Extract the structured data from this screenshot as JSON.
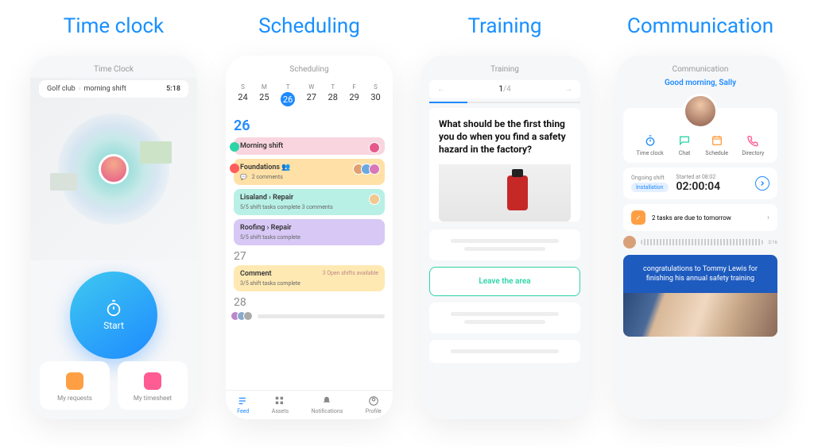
{
  "headings": [
    "Time clock",
    "Scheduling",
    "Training",
    "Communication"
  ],
  "timeclock": {
    "title": "Time Clock",
    "breadcrumb": {
      "location": "Golf club",
      "shift": "morning shift"
    },
    "elapsed": "5:18",
    "start_label": "Start",
    "tiles": {
      "requests": "My requests",
      "timesheet": "My timesheet"
    }
  },
  "scheduling": {
    "title": "Scheduling",
    "week": [
      {
        "dow": "S",
        "num": "24"
      },
      {
        "dow": "M",
        "num": "25"
      },
      {
        "dow": "T",
        "num": "26",
        "active": true
      },
      {
        "dow": "W",
        "num": "27"
      },
      {
        "dow": "T",
        "num": "28"
      },
      {
        "dow": "F",
        "num": "29"
      },
      {
        "dow": "S",
        "num": "30"
      }
    ],
    "big_day": "26",
    "cards": [
      {
        "title": "Morning shift",
        "color": "#f9d5e0",
        "comments": ""
      },
      {
        "title": "Foundations",
        "color": "#ffe0a6",
        "people_icon": true,
        "meta": "2 comments"
      },
      {
        "title": "Lisaland  ›  Repair",
        "color": "#b8f0e6",
        "meta": "5/5 shift tasks complete   3 comments"
      },
      {
        "title": "Roofing  ›  Repair",
        "color": "#d7c8f5",
        "meta": "5/5 shift tasks complete"
      }
    ],
    "day27": "27",
    "card27": {
      "title": "Comment",
      "color": "#ffe9b3",
      "open": "3  Open shifts available",
      "meta": "3/5 shift tasks complete"
    },
    "day28": "28",
    "nav": [
      "Feed",
      "Assets",
      "Notifications",
      "Profile"
    ]
  },
  "training": {
    "title": "Training",
    "page": {
      "cur": "1",
      "total": "/4"
    },
    "question": "What should be the first thing you do when you find a safety hazard in the factory?",
    "correct": "Leave the area"
  },
  "communication": {
    "title": "Communication",
    "greeting": "Good morning, Sally",
    "actions": [
      "Time clock",
      "Chat",
      "Schedule",
      "Directory"
    ],
    "shift": {
      "label": "Ongoing shift",
      "badge": "Installation",
      "started_label": "Started at 08:02",
      "elapsed": "02:00:04"
    },
    "due": "2 tasks are due to tomorrow",
    "audio_duration": "3:16",
    "banner": "congratulations to Tommy Lewis for finishing his annual safety training"
  }
}
